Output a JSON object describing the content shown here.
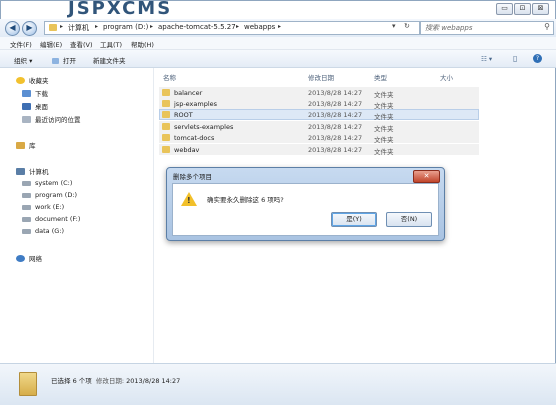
{
  "watermark": "JSPXCMS",
  "window_buttons": {
    "minimize": "▭",
    "maximize": "⊡",
    "close": "⊠"
  },
  "nav_buttons": {
    "back": "◀",
    "forward": "▶"
  },
  "address": {
    "crumbs": [
      "计算机",
      "program (D:)",
      "apache-tomcat-5.5.27",
      "webapps"
    ],
    "separator": "▸",
    "dropdown": "▾",
    "refresh": "↻"
  },
  "search": {
    "placeholder": "搜索 webapps",
    "icon": "search-icon"
  },
  "menu": [
    "文件(F)",
    "编辑(E)",
    "查看(V)",
    "工具(T)",
    "帮助(H)"
  ],
  "toolbar": {
    "organize": "组织 ▾",
    "open": "打开",
    "new_folder": "新建文件夹",
    "view_icon": "☷ ▾",
    "pane_icon": "▯",
    "help_icon": "?"
  },
  "sidebar": {
    "favorites": "收藏夹",
    "fav_items": [
      "下载",
      "桌面",
      "最近访问的位置"
    ],
    "libraries": "库",
    "computer": "计算机",
    "drives": [
      "system (C:)",
      "program (D:)",
      "work (E:)",
      "document (F:)",
      "data (G:)"
    ],
    "network": "网络"
  },
  "columns": {
    "name": "名称",
    "date": "修改日期",
    "type": "类型",
    "size": "大小"
  },
  "files": [
    {
      "name": "balancer",
      "date": "2013/8/28 14:27",
      "type": "文件夹"
    },
    {
      "name": "jsp-examples",
      "date": "2013/8/28 14:27",
      "type": "文件夹"
    },
    {
      "name": "ROOT",
      "date": "2013/8/28 14:27",
      "type": "文件夹"
    },
    {
      "name": "servlets-examples",
      "date": "2013/8/28 14:27",
      "type": "文件夹"
    },
    {
      "name": "tomcat-docs",
      "date": "2013/8/28 14:27",
      "type": "文件夹"
    },
    {
      "name": "webdav",
      "date": "2013/8/28 14:27",
      "type": "文件夹"
    }
  ],
  "dialog": {
    "title": "删除多个项目",
    "close": "✕",
    "message": "确实要永久删除这 6 项吗?",
    "yes": "是(Y)",
    "no": "否(N)"
  },
  "status": {
    "selected": "已选择 6 个项",
    "date_label": "修改日期:",
    "date": "2013/8/28 14:27"
  },
  "colors": {
    "folder": "#e9c45a",
    "selection": "#dde8f6",
    "dialog_frame": "#a9c3e2",
    "close_red": "#c1452b"
  }
}
